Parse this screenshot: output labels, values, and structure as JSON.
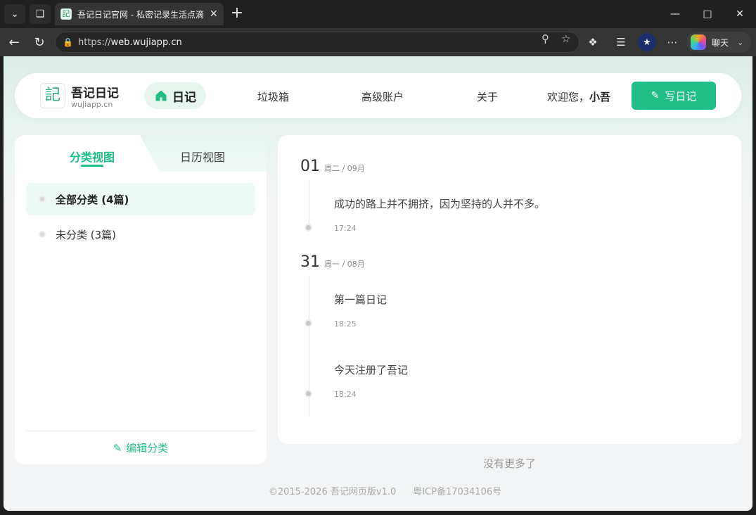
{
  "browser": {
    "tab_title": "吾记日记官网 - 私密记录生活点滴",
    "tab_favicon": "記",
    "url_prefix": "https://",
    "url_domain": "web.wujiapp.cn",
    "copilot_label": "聊天"
  },
  "header": {
    "logo_glyph": "記",
    "brand_name": "吾记日记",
    "brand_domain": "wujiapp.cn",
    "nav": {
      "diary": "日记",
      "trash": "垃圾箱",
      "premium": "高级账户",
      "about": "关于"
    },
    "welcome_prefix": "欢迎您，",
    "username": "小吾",
    "write_button": "写日记"
  },
  "sidebar": {
    "tabs": {
      "category": "分类视图",
      "calendar": "日历视图"
    },
    "categories": [
      {
        "label": "全部分类 (4篇)",
        "active": true
      },
      {
        "label": "未分类 (3篇)",
        "active": false
      }
    ],
    "edit_label": "编辑分类"
  },
  "timeline": {
    "groups": [
      {
        "day": "01",
        "meta": "周二 / 09月",
        "entries": [
          {
            "text": "成功的路上并不拥挤，因为坚持的人并不多。",
            "time": "17:24"
          }
        ]
      },
      {
        "day": "31",
        "meta": "周一 / 08月",
        "entries": [
          {
            "text": "第一篇日记",
            "time": "18:25"
          },
          {
            "text": "今天注册了吾记",
            "time": "18:24"
          }
        ]
      }
    ],
    "no_more": "没有更多了"
  },
  "footer": {
    "copyright": "©2015-2026 吾记网页版v1.0",
    "icp": "粤ICP备17034106号"
  },
  "colors": {
    "accent": "#20bd86",
    "accent_light": "#eef8f4"
  }
}
